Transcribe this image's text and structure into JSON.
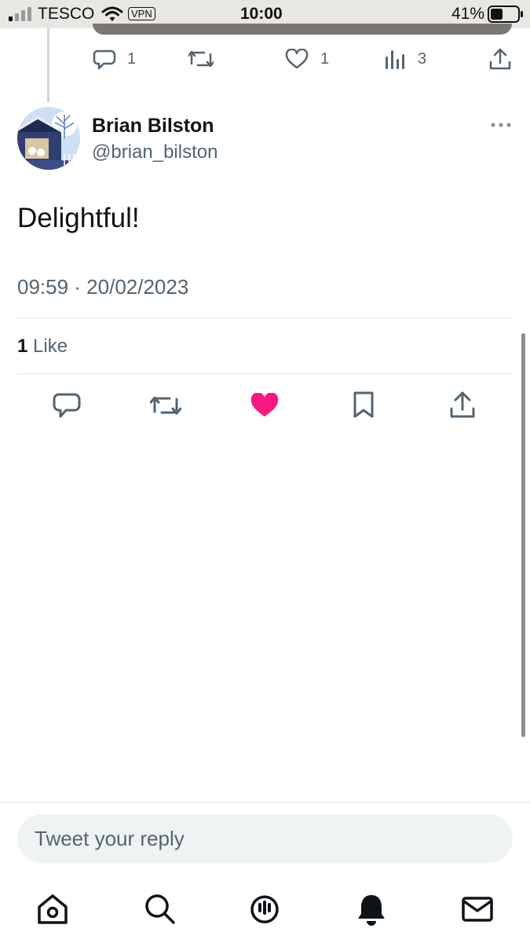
{
  "status_bar": {
    "carrier": "TESCO",
    "vpn": "VPN",
    "time": "10:00",
    "battery": "41%"
  },
  "previous_tweet": {
    "reply_count": "1",
    "like_count": "1",
    "views_count": "3"
  },
  "tweet": {
    "author_name": "Brian Bilston",
    "author_handle": "@brian_bilston",
    "text": "Delightful!",
    "meta": "09:59 · 20/02/2023",
    "likes_count": "1",
    "likes_label": "Like",
    "liked": true
  },
  "reply": {
    "placeholder": "Tweet your reply"
  },
  "colors": {
    "like_pink": "#f91880",
    "icon_gray": "#536471",
    "text_dark": "#0f1419"
  },
  "tabs": [
    "home-icon",
    "search-icon",
    "spaces-icon",
    "notifications-icon",
    "messages-icon"
  ]
}
